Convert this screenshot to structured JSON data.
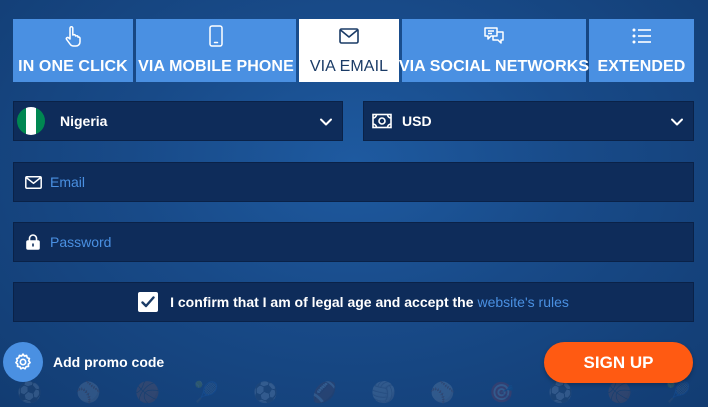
{
  "tabs": [
    {
      "label": "IN ONE CLICK",
      "icon": "tap-finger-icon",
      "active": false
    },
    {
      "label": "VIA MOBILE PHONE",
      "icon": "mobile-phone-icon",
      "active": false
    },
    {
      "label": "VIA EMAIL",
      "icon": "envelope-icon",
      "active": true
    },
    {
      "label": "VIA SOCIAL NETWORKS",
      "icon": "chat-bubbles-icon",
      "active": false
    },
    {
      "label": "EXTENDED",
      "icon": "list-icon",
      "active": false
    }
  ],
  "country_select": {
    "value": "Nigeria",
    "flag_colors": [
      "#008751",
      "#ffffff",
      "#008751"
    ]
  },
  "currency_select": {
    "value": "USD"
  },
  "email": {
    "placeholder": "Email",
    "value": ""
  },
  "password": {
    "placeholder": "Password",
    "value": ""
  },
  "confirm": {
    "checked": true,
    "text": "I confirm that I am of legal age and accept the",
    "link_text": "website's rules"
  },
  "promo": {
    "label": "Add promo code"
  },
  "signup": {
    "label": "SIGN UP"
  },
  "colors": {
    "accent": "#4a90e2",
    "signup": "#ff5a12",
    "field_bg": "#0e2c5a",
    "background": "#184a88"
  }
}
